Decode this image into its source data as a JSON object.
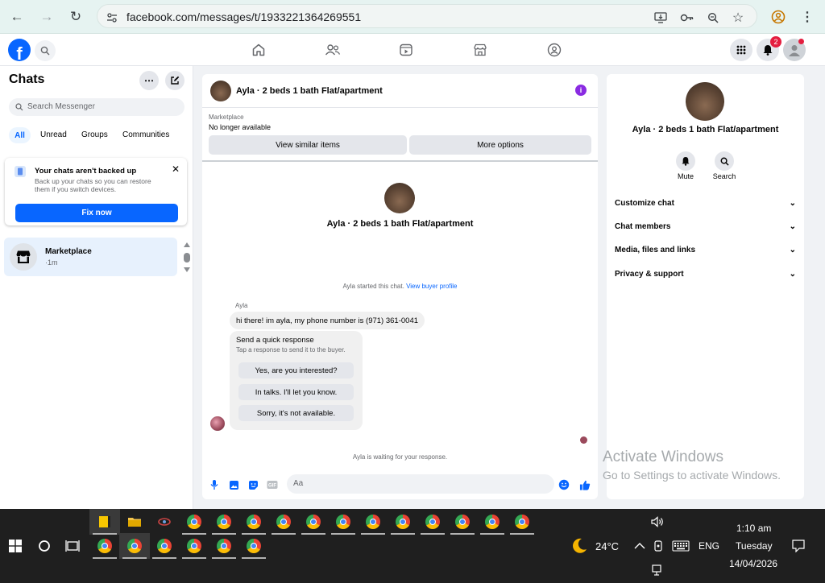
{
  "browser": {
    "url": "facebook.com/messages/t/1933221364269551"
  },
  "fb": {
    "notification_count": "2"
  },
  "sidebar": {
    "title": "Chats",
    "search_placeholder": "Search Messenger",
    "filters": [
      "All",
      "Unread",
      "Groups",
      "Communities"
    ],
    "backup": {
      "title": "Your chats aren't backed up",
      "description": "Back up your chats so you can restore them if you switch devices.",
      "button": "Fix now"
    },
    "chats": [
      {
        "name": "Marketplace",
        "time": "·1m"
      }
    ]
  },
  "chat": {
    "header_title": "Ayla · 2 beds 1 bath Flat/apartment",
    "marketplace_label": "Marketplace",
    "listing_status": "No longer available",
    "view_similar": "View similar items",
    "more_options": "More options",
    "intro_title": "Ayla · 2 beds 1 bath Flat/apartment",
    "started_text": "Ayla started this chat.",
    "started_link": "View buyer profile",
    "sender_name": "Ayla",
    "message": "hi there! im ayla, my phone number is (971) 361-0041",
    "quick_title": "Send a quick response",
    "quick_subtitle": "Tap a response to send it to the buyer.",
    "quick_responses": [
      "Yes, are you interested?",
      "In talks. I'll let you know.",
      "Sorry, it's not available."
    ],
    "waiting_text": "Ayla is waiting for your response.",
    "compose_placeholder": "Aa"
  },
  "details": {
    "title": "Ayla · 2 beds 1 bath Flat/apartment",
    "actions": [
      "Mute",
      "Search"
    ],
    "sections": [
      "Customize chat",
      "Chat members",
      "Media, files and links",
      "Privacy & support"
    ]
  },
  "watermark": {
    "line1": "Activate Windows",
    "line2": "Go to Settings to activate Windows."
  },
  "taskbar": {
    "weather": "24°C",
    "language": "ENG",
    "time": "1:10 am",
    "day": "Tuesday",
    "date": "14/04/2026"
  },
  "colors": {
    "fb_blue": "#0866ff",
    "badge_red": "#e41e3f",
    "info_purple": "#8a2be2"
  }
}
